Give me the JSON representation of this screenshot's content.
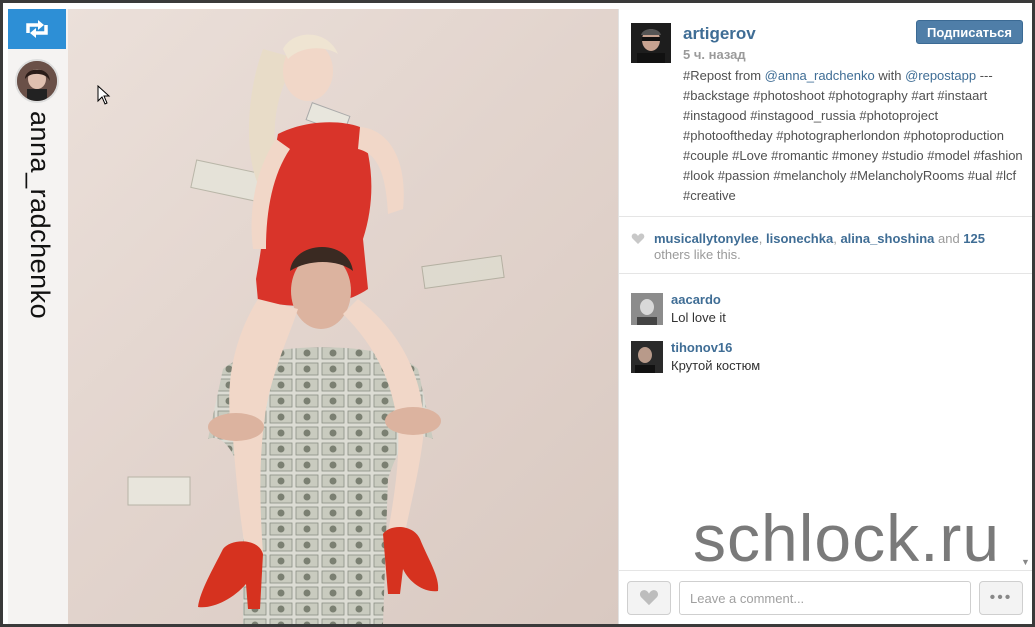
{
  "repost": {
    "username": "anna_radchenko",
    "icon": "repost-icon",
    "icon_color": "#2d8fd6"
  },
  "post": {
    "owner": "artigerov",
    "time": "5 ч. назад",
    "follow_label": "Подписаться",
    "caption_parts": {
      "p1": "#Repost from ",
      "m1": "@anna_radchenko",
      "p2": " with ",
      "m2": "@repostapp",
      "p3": " --- #backstage #photoshoot #photography #art #instaart #instagood #instagood_russia #photoproject #photooftheday #photographerlondon #photoproduction #couple #Love #romantic #money #studio #model #fashion #look #passion #melancholy #MelancholyRooms #ual #lcf #creative"
    }
  },
  "likes": {
    "user1": "musicallytonylee",
    "sep1": ", ",
    "user2": "lisonechka",
    "sep2": ", ",
    "user3": "alina_shoshina",
    "and": " and ",
    "count": "125",
    "rest": " others like this."
  },
  "comments": [
    {
      "user": "aacardo",
      "text": "Lol love it"
    },
    {
      "user": "tihonov16",
      "text": "Крутой костюм"
    }
  ],
  "footer": {
    "comment_placeholder": "Leave a comment...",
    "more_label": "•••"
  },
  "watermark": "schlock.ru",
  "colors": {
    "link": "#3f6d95",
    "follow_button": "#4f7ea8",
    "dress": "#d9342a"
  }
}
